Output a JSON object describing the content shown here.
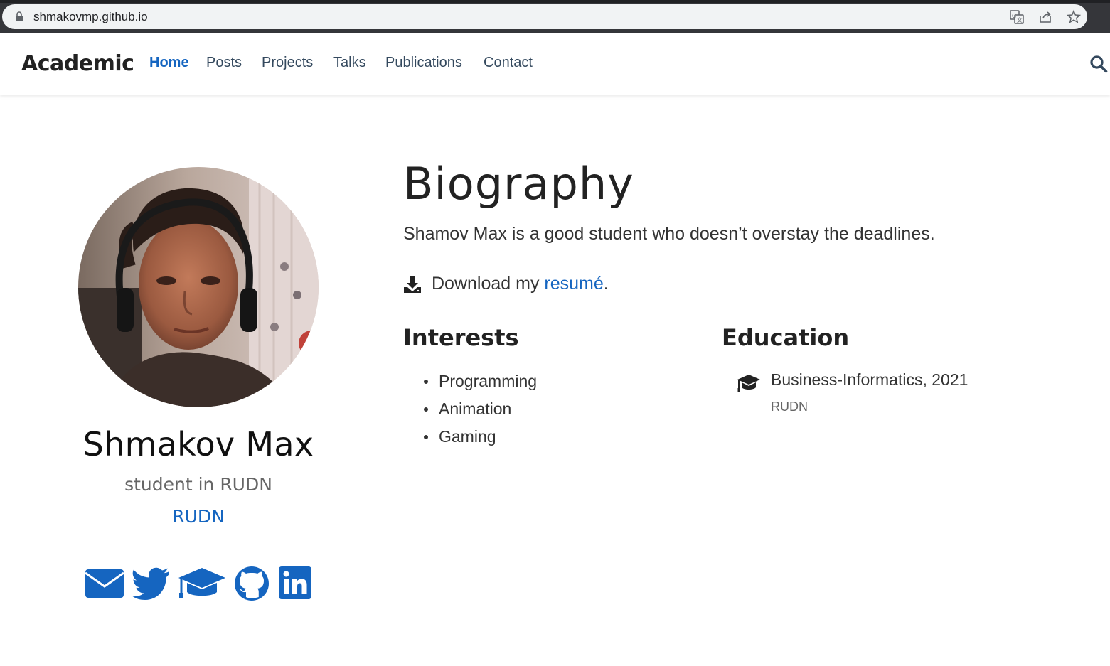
{
  "browser": {
    "url": "shmakovmp.github.io"
  },
  "navbar": {
    "brand": "Academic",
    "items": [
      {
        "label": "Home",
        "active": true
      },
      {
        "label": "Posts"
      },
      {
        "label": "Projects"
      },
      {
        "label": "Talks"
      },
      {
        "label": "Publications"
      },
      {
        "label": "Contact"
      }
    ]
  },
  "profile": {
    "name": "Shmakov Max",
    "role": "student in RUDN",
    "organization": "RUDN",
    "social": [
      "envelope-icon",
      "twitter-icon",
      "graduation-cap-icon",
      "github-icon",
      "linkedin-icon"
    ]
  },
  "biography": {
    "title": "Biography",
    "text": "Shamov Max is a good student who doesn’t overstay the deadlines.",
    "download_prefix": "Download my ",
    "download_link": "resumé",
    "download_suffix": "."
  },
  "interests": {
    "heading": "Interests",
    "items": [
      "Programming",
      "Animation",
      "Gaming"
    ]
  },
  "education": {
    "heading": "Education",
    "course": "Business-Informatics, 2021",
    "institution": "RUDN"
  },
  "colors": {
    "accent": "#1565c0",
    "text": "#222222"
  }
}
